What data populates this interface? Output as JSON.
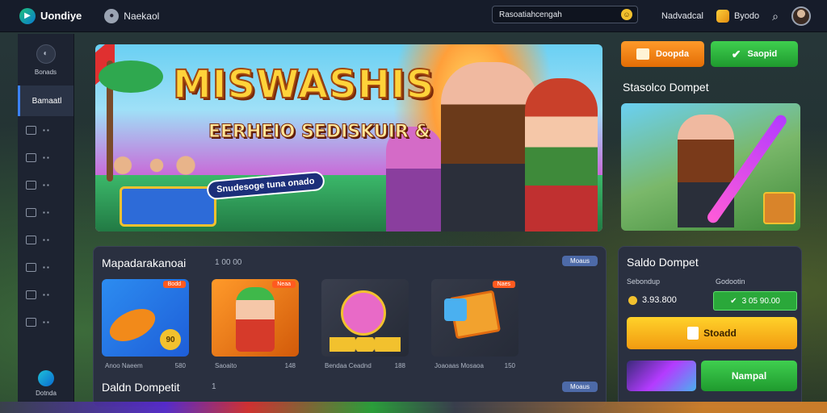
{
  "app": {
    "logo_text": "Uondiye",
    "brand2_text": "Naekaol"
  },
  "topbar": {
    "search_value": "Rasoatiahcengah",
    "link1": "Nadvadcal",
    "link2": "Byodo"
  },
  "sidebar": {
    "top_label": "Bonads",
    "active_label": "Bamaatl",
    "items": [
      {
        "icon": "controller-icon"
      },
      {
        "icon": "window-icon"
      },
      {
        "icon": "grid-icon"
      },
      {
        "icon": "shield-icon"
      },
      {
        "icon": "camera-icon"
      },
      {
        "icon": "clock-icon"
      },
      {
        "icon": "chat-icon"
      },
      {
        "icon": "gift-icon"
      }
    ],
    "bottom_label": "Dotnda"
  },
  "hero": {
    "title": "MISWASHIS",
    "subtitle": "EERHEIO SEDISKUIR &",
    "tag": "Snudesoge tuna onado"
  },
  "right_actions": {
    "orange_label": "Doopda",
    "green_label": "Saopid"
  },
  "side_banner": {
    "title": "Stasolco Dompet"
  },
  "games_panel": {
    "title": "Mapadarakanoai",
    "count": "1 00 00",
    "badge": "Moaus",
    "cards": [
      {
        "badge": "Bodd",
        "name": "Anoo Naeem",
        "value": "580",
        "coin_text": "90"
      },
      {
        "badge": "Neaa",
        "name": "Saoaito",
        "value": "148",
        "coin_text": ""
      },
      {
        "badge": "",
        "name": "Bendaa Ceadnd",
        "value": "188",
        "coin_text": ""
      },
      {
        "badge": "Naes",
        "name": "Joaoaas Mosaoa",
        "value": "150",
        "coin_text": ""
      }
    ],
    "section2_title": "Daldn Dompetit",
    "section2_count": "1",
    "section2_badge": "Moaus"
  },
  "wallet": {
    "title": "Saldo Dompet",
    "label_left": "Sebondup",
    "label_right": "Godootin",
    "amount": "3.93.800",
    "green_value": "3 05 90.00",
    "big_button": "Stoadd",
    "bottom_button": "Nampal"
  }
}
